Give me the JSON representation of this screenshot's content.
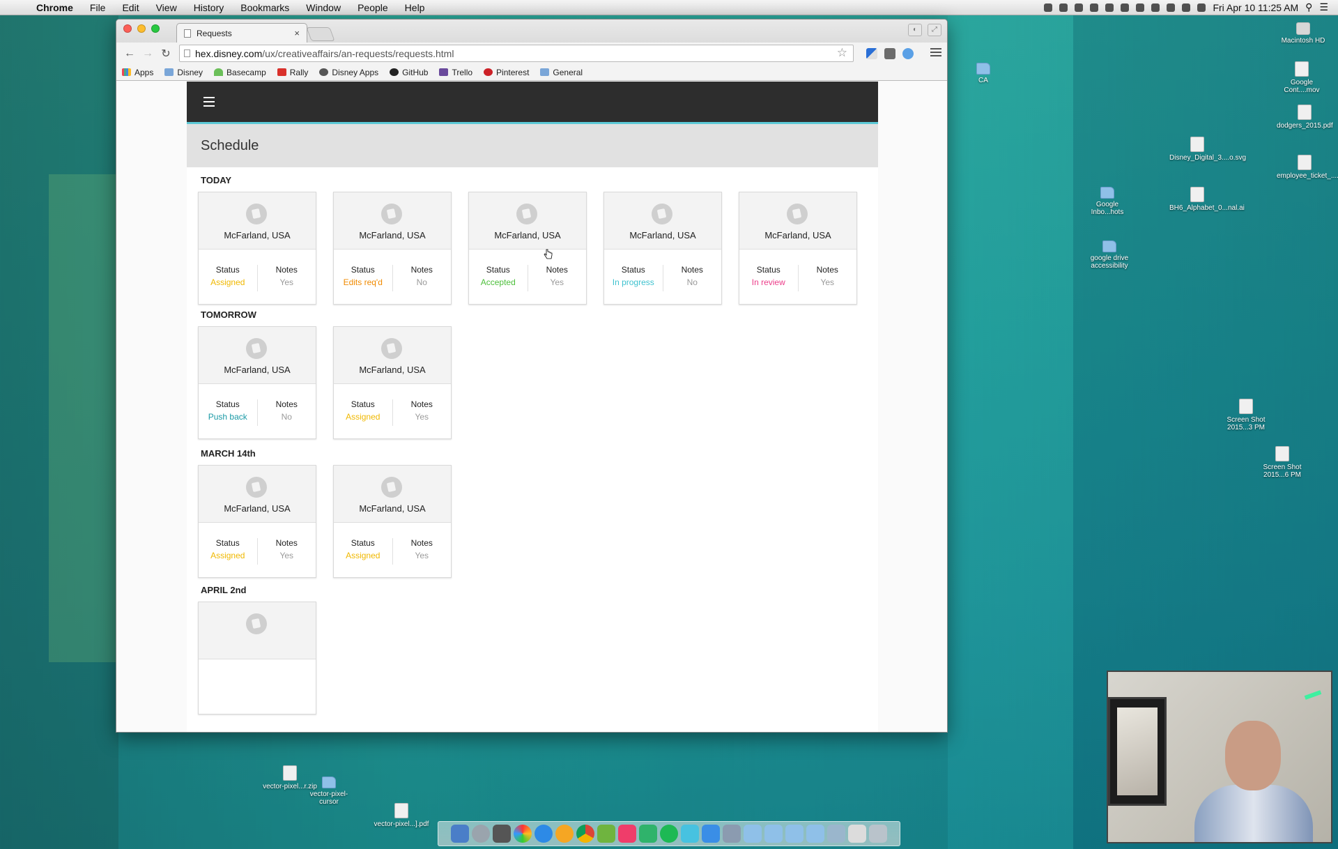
{
  "menubar": {
    "app": "Chrome",
    "items": [
      "File",
      "Edit",
      "View",
      "History",
      "Bookmarks",
      "Window",
      "People",
      "Help"
    ],
    "clock": "Fri Apr 10  11:25 AM"
  },
  "browser": {
    "tab_title": "Requests",
    "url_host": "hex.disney.com",
    "url_path": "/ux/creativeaffairs/an-requests/requests.html",
    "bookmarks": [
      "Apps",
      "Disney",
      "Basecamp",
      "Rally",
      "Disney Apps",
      "GitHub",
      "Trello",
      "Pinterest",
      "General"
    ]
  },
  "page": {
    "header": "Schedule",
    "sections": [
      {
        "title": "TODAY",
        "cards": [
          {
            "location": "McFarland, USA",
            "status_label": "Status",
            "status": "Assigned",
            "status_color": "#f0b800",
            "notes_label": "Notes",
            "notes": "Yes"
          },
          {
            "location": "McFarland, USA",
            "status_label": "Status",
            "status": "Edits req'd",
            "status_color": "#f08a00",
            "notes_label": "Notes",
            "notes": "No"
          },
          {
            "location": "McFarland, USA",
            "status_label": "Status",
            "status": "Accepted",
            "status_color": "#4cbf3a",
            "notes_label": "Notes",
            "notes": "Yes"
          },
          {
            "location": "McFarland, USA",
            "status_label": "Status",
            "status": "In progress",
            "status_color": "#3fc2cf",
            "notes_label": "Notes",
            "notes": "No"
          },
          {
            "location": "McFarland, USA",
            "status_label": "Status",
            "status": "In review",
            "status_color": "#ec3e8a",
            "notes_label": "Notes",
            "notes": "Yes"
          }
        ]
      },
      {
        "title": "TOMORROW",
        "cards": [
          {
            "location": "McFarland, USA",
            "status_label": "Status",
            "status": "Push back",
            "status_color": "#1a9aa6",
            "notes_label": "Notes",
            "notes": "No"
          },
          {
            "location": "McFarland, USA",
            "status_label": "Status",
            "status": "Assigned",
            "status_color": "#f0b800",
            "notes_label": "Notes",
            "notes": "Yes"
          }
        ]
      },
      {
        "title": "MARCH 14th",
        "cards": [
          {
            "location": "McFarland, USA",
            "status_label": "Status",
            "status": "Assigned",
            "status_color": "#f0b800",
            "notes_label": "Notes",
            "notes": "Yes"
          },
          {
            "location": "McFarland, USA",
            "status_label": "Status",
            "status": "Assigned",
            "status_color": "#f0b800",
            "notes_label": "Notes",
            "notes": "Yes"
          }
        ]
      },
      {
        "title": "APRIL 2nd",
        "cards": []
      }
    ]
  },
  "desktop": {
    "icons": [
      {
        "label": "Macintosh HD",
        "type": "disk"
      },
      {
        "label": "Google Cont....mov",
        "type": "file"
      },
      {
        "label": "dodgers_2015.pdf",
        "type": "file"
      },
      {
        "label": "employee_ticket_....pdf",
        "type": "file"
      },
      {
        "label": "CA",
        "type": "folder"
      },
      {
        "label": "Disney_Digital_3....o.svg",
        "type": "file"
      },
      {
        "label": "Google Inbo...hots",
        "type": "folder"
      },
      {
        "label": "BH6_Alphabet_0...nal.ai",
        "type": "file"
      },
      {
        "label": "google drive accessibility",
        "type": "folder"
      },
      {
        "label": "Screen Shot 2015...3 PM",
        "type": "file"
      },
      {
        "label": "Screen Shot 2015...6 PM",
        "type": "file"
      },
      {
        "label": "vector-pixel...r.zip",
        "type": "file"
      },
      {
        "label": "vector-pixel-cursor",
        "type": "folder"
      },
      {
        "label": "vector-pixel...].pdf",
        "type": "file"
      }
    ]
  }
}
